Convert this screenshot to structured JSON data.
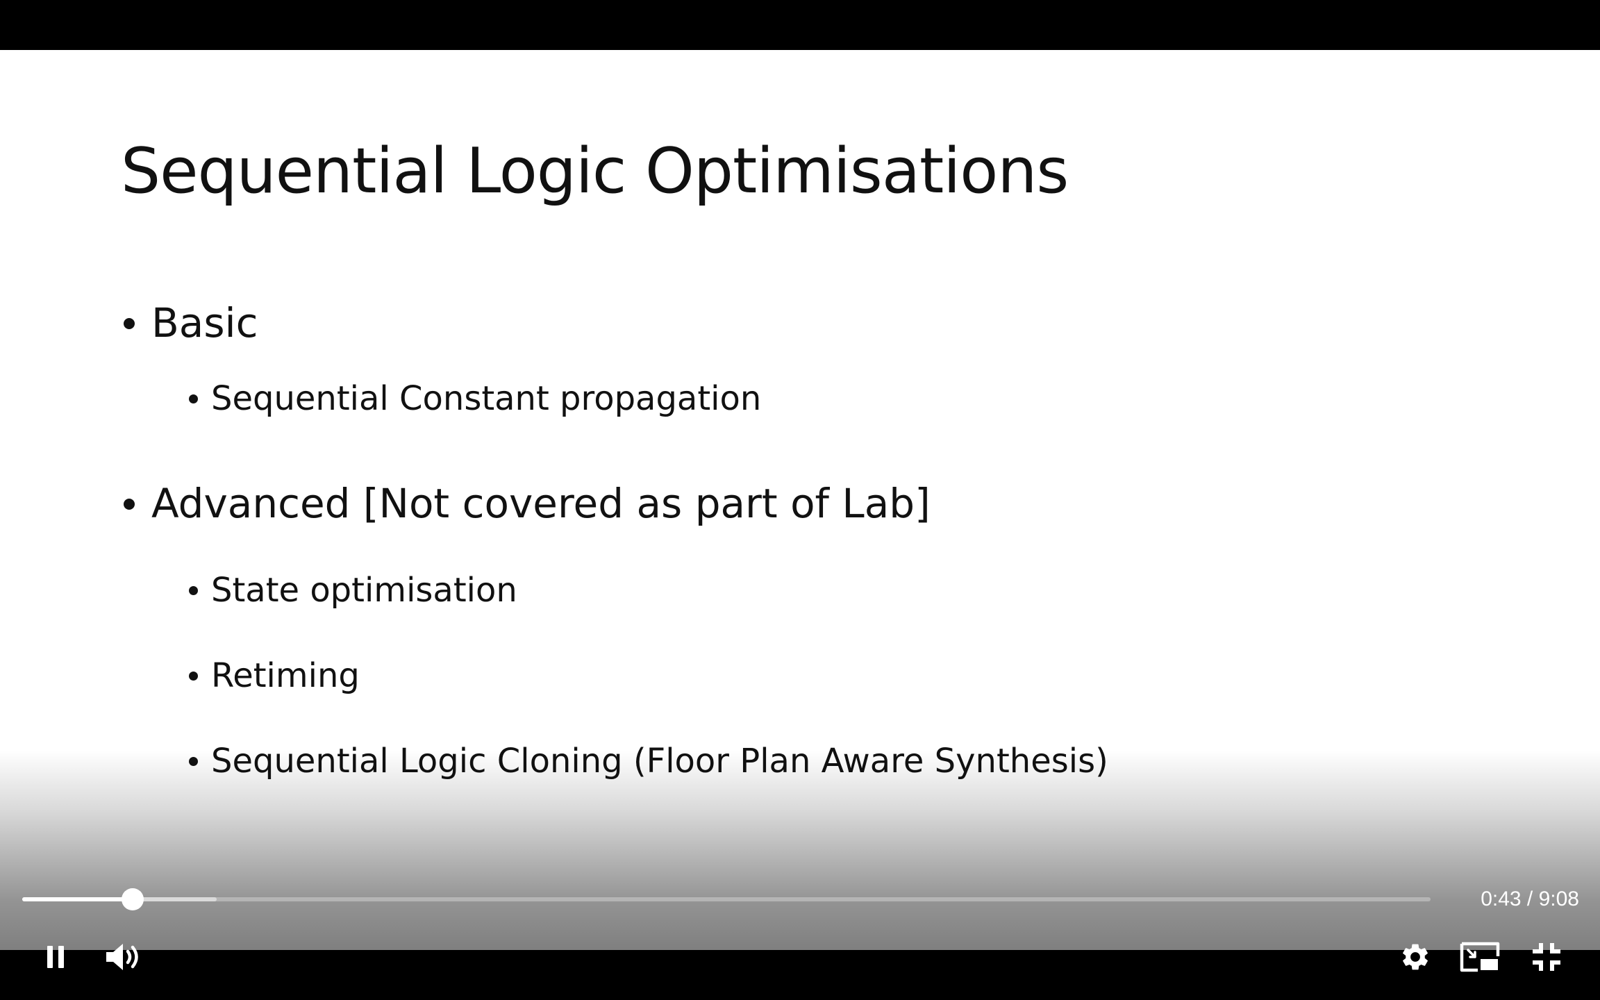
{
  "slide": {
    "title": "Sequential Logic Optimisations",
    "bullets": [
      {
        "level": 1,
        "text": "Basic"
      },
      {
        "level": 2,
        "text": "Sequential Constant propagation"
      },
      {
        "level": 1,
        "text": "Advanced [Not covered as part of Lab]"
      },
      {
        "level": 2,
        "text": "State optimisation"
      },
      {
        "level": 2,
        "text": "Retiming"
      },
      {
        "level": 2,
        "text": "Sequential Logic Cloning (Floor Plan Aware Synthesis)"
      }
    ]
  },
  "player": {
    "time_display": "0:43 / 9:08",
    "played_fraction": 0.0785,
    "buffered_fraction": 0.138,
    "controls": {
      "play_pause_icon": "pause-icon",
      "volume_icon": "volume-icon",
      "settings_icon": "gear-icon",
      "miniplayer_icon": "miniplayer-icon",
      "fullscreen_icon": "exit-fullscreen-icon"
    },
    "colors": {
      "progress_played": "#ffffff",
      "slide_background": "#ffffff",
      "letterbox": "#000000"
    }
  }
}
